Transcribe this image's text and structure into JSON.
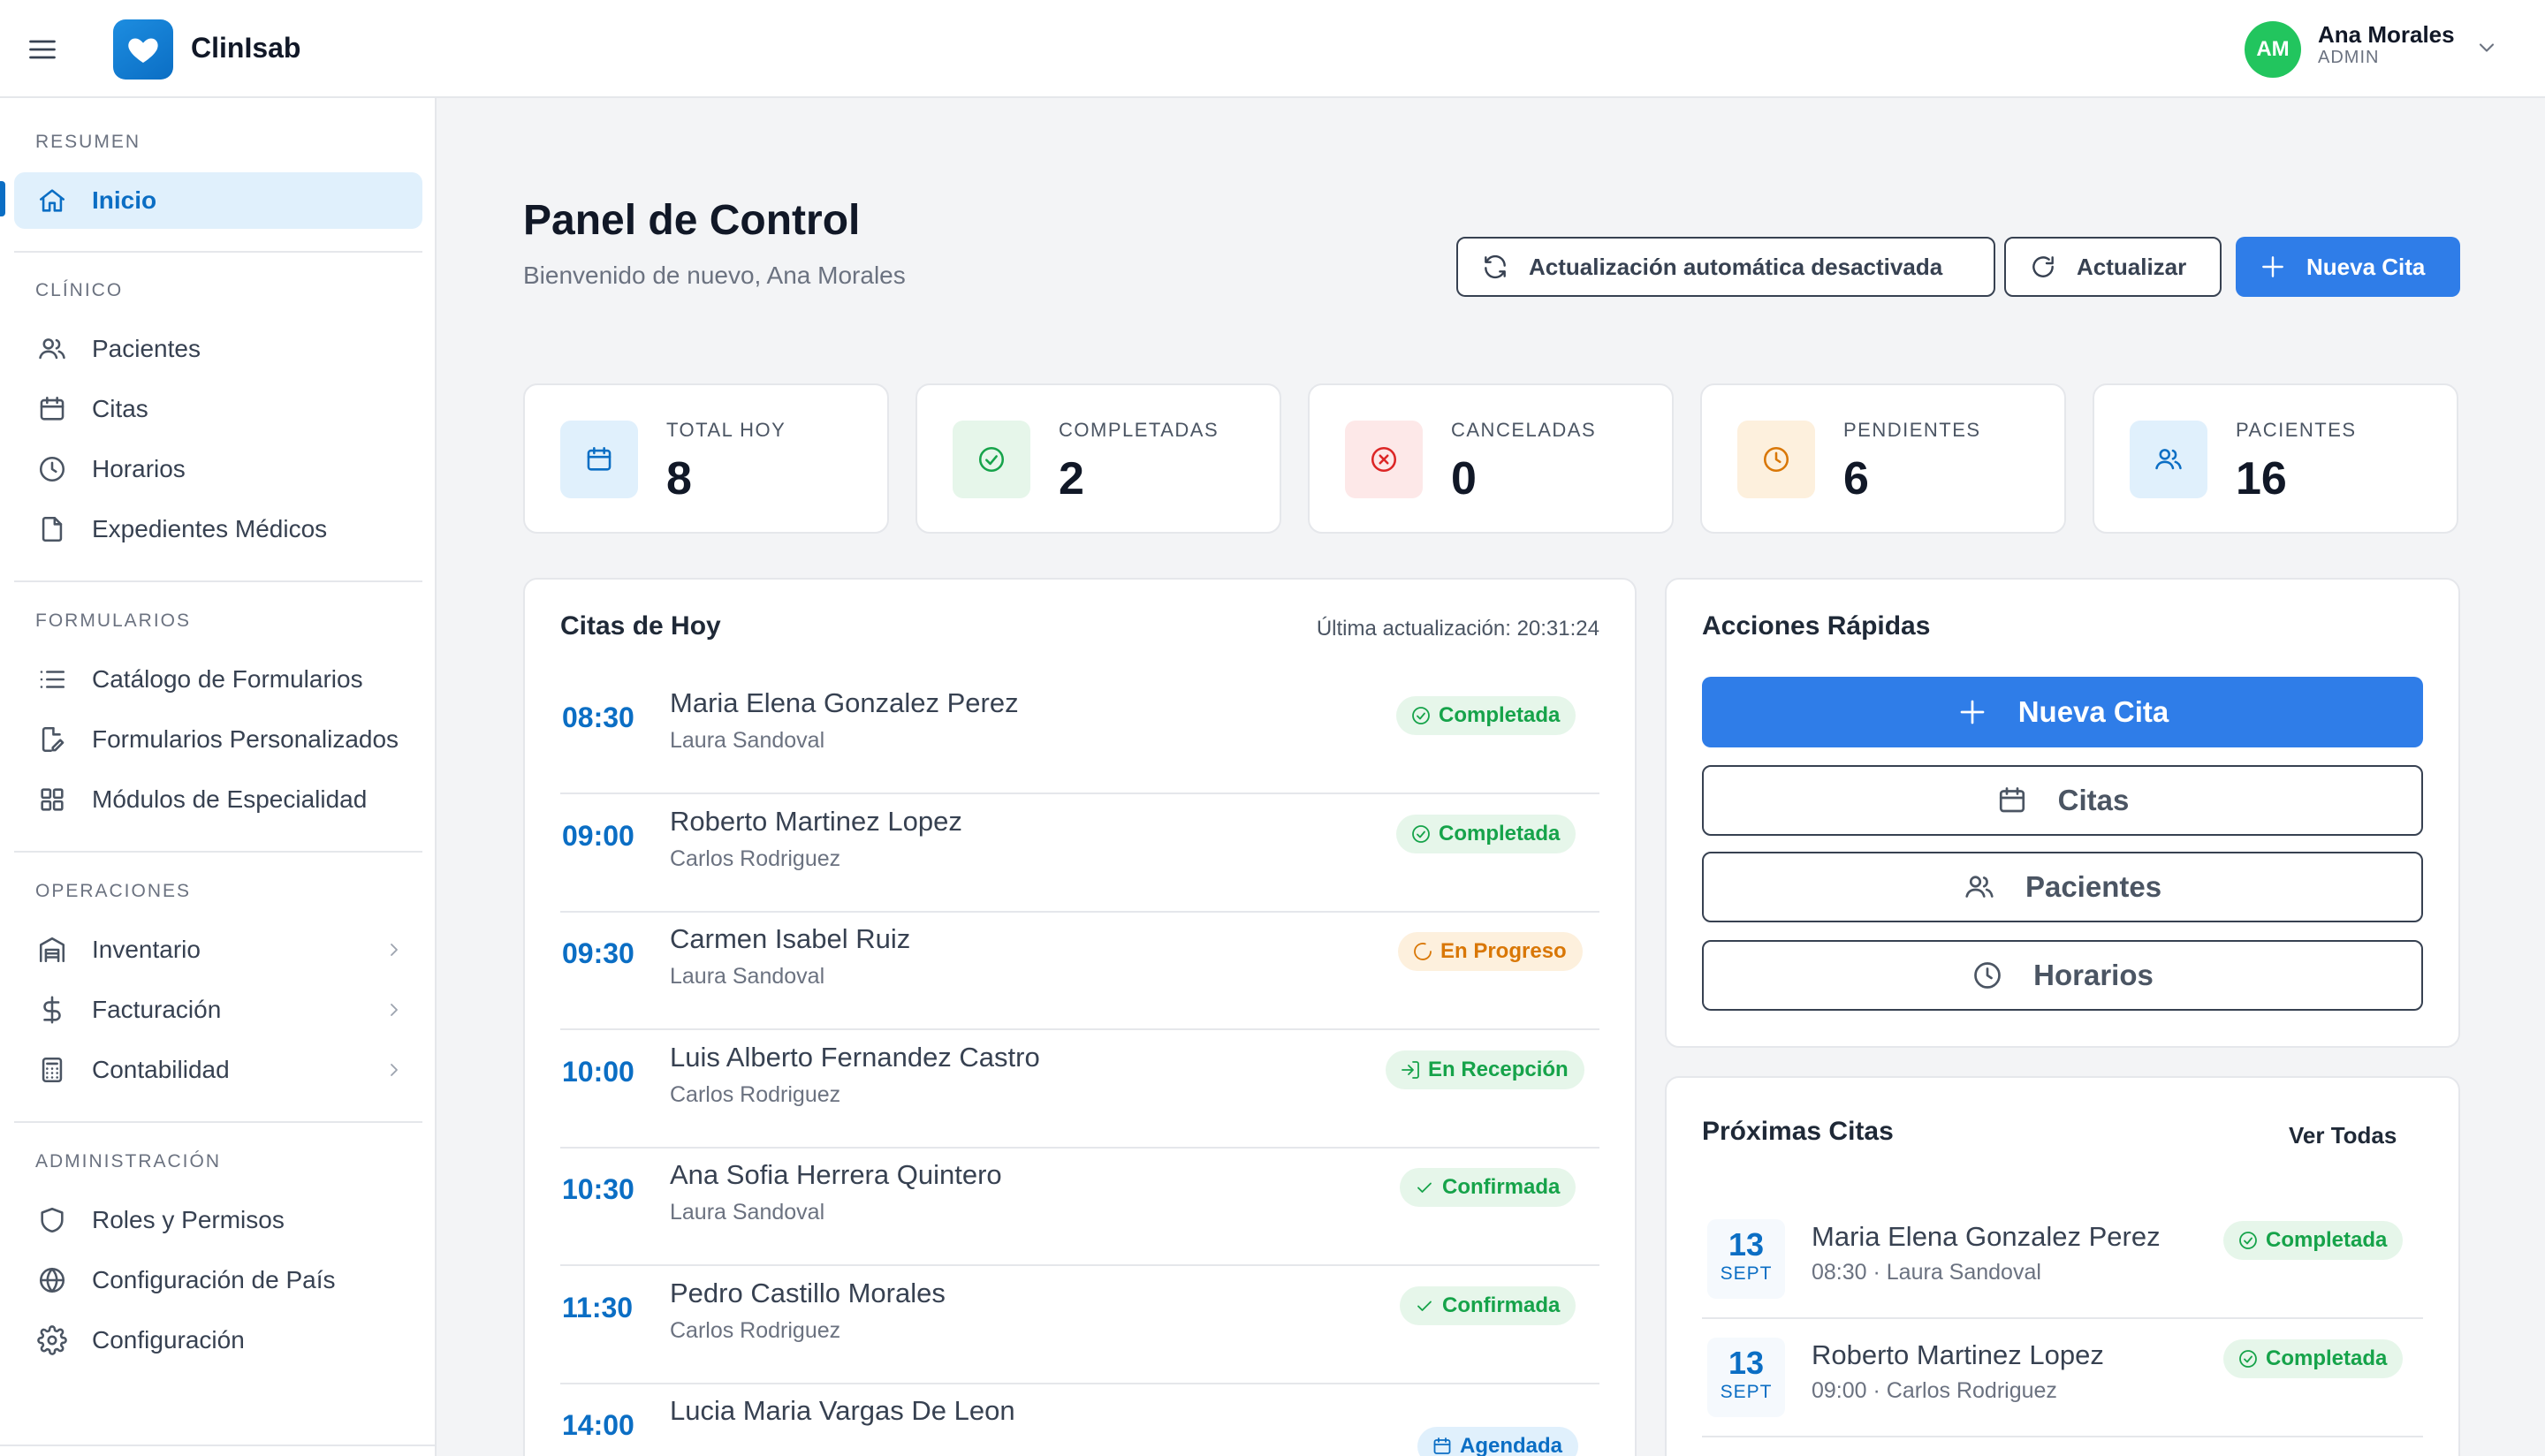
{
  "app": {
    "brand": "ClinIsab"
  },
  "user": {
    "name": "Ana Morales",
    "role": "ADMIN",
    "initials": "AM"
  },
  "sidebar": {
    "sections": [
      {
        "title": "RESUMEN",
        "items": [
          {
            "label": "Inicio",
            "icon": "home-icon",
            "active": true
          }
        ]
      },
      {
        "title": "CLÍNICO",
        "items": [
          {
            "label": "Pacientes",
            "icon": "users-icon"
          },
          {
            "label": "Citas",
            "icon": "calendar-icon"
          },
          {
            "label": "Horarios",
            "icon": "clock-icon"
          },
          {
            "label": "Expedientes Médicos",
            "icon": "file-icon"
          }
        ]
      },
      {
        "title": "FORMULARIOS",
        "items": [
          {
            "label": "Catálogo de Formularios",
            "icon": "list-icon"
          },
          {
            "label": "Formularios Personalizados",
            "icon": "file-edit-icon"
          },
          {
            "label": "Módulos de Especialidad",
            "icon": "grid-icon"
          }
        ]
      },
      {
        "title": "OPERACIONES",
        "items": [
          {
            "label": "Inventario",
            "icon": "warehouse-icon",
            "expandable": true
          },
          {
            "label": "Facturación",
            "icon": "dollar-icon",
            "expandable": true
          },
          {
            "label": "Contabilidad",
            "icon": "calculator-icon",
            "expandable": true
          }
        ]
      },
      {
        "title": "ADMINISTRACIÓN",
        "items": [
          {
            "label": "Roles y Permisos",
            "icon": "shield-icon"
          },
          {
            "label": "Configuración de País",
            "icon": "globe-icon"
          },
          {
            "label": "Configuración",
            "icon": "gear-icon"
          }
        ]
      }
    ]
  },
  "header": {
    "title": "Panel de Control",
    "subtitle": "Bienvenido de nuevo, Ana Morales",
    "auto_refresh_label": "Actualización automática desactivada",
    "refresh_label": "Actualizar",
    "new_appointment_label": "Nueva Cita"
  },
  "stats": [
    {
      "label": "TOTAL HOY",
      "value": "8",
      "icon": "calendar-icon",
      "color": "#0b6ec4",
      "bg": "#e0f0fc"
    },
    {
      "label": "COMPLETADAS",
      "value": "2",
      "icon": "check-circle-icon",
      "color": "#16a34a",
      "bg": "#e6f6ea"
    },
    {
      "label": "CANCELADAS",
      "value": "0",
      "icon": "x-circle-icon",
      "color": "#dc2626",
      "bg": "#fde8e8"
    },
    {
      "label": "PENDIENTES",
      "value": "6",
      "icon": "clock-icon",
      "color": "#d97706",
      "bg": "#fdf0dd"
    },
    {
      "label": "PACIENTES",
      "value": "16",
      "icon": "users-icon",
      "color": "#0b6ec4",
      "bg": "#e0f0fc"
    }
  ],
  "today": {
    "title": "Citas de Hoy",
    "last_update": "Última actualización: 20:31:24",
    "appointments": [
      {
        "time": "08:30",
        "patient": "Maria Elena Gonzalez Perez",
        "doctor": "Laura Sandoval",
        "status": "Completada",
        "variant": "green",
        "icon": "check-circle-icon"
      },
      {
        "time": "09:00",
        "patient": "Roberto Martinez Lopez",
        "doctor": "Carlos Rodriguez",
        "status": "Completada",
        "variant": "green",
        "icon": "check-circle-icon"
      },
      {
        "time": "09:30",
        "patient": "Carmen Isabel Ruiz",
        "doctor": "Laura Sandoval",
        "status": "En Progreso",
        "variant": "orange",
        "icon": "loader-icon"
      },
      {
        "time": "10:00",
        "patient": "Luis Alberto Fernandez Castro",
        "doctor": "Carlos Rodriguez",
        "status": "En Recepción",
        "variant": "green",
        "icon": "login-icon"
      },
      {
        "time": "10:30",
        "patient": "Ana Sofia Herrera Quintero",
        "doctor": "Laura Sandoval",
        "status": "Confirmada",
        "variant": "green",
        "icon": "check-icon"
      },
      {
        "time": "11:30",
        "patient": "Pedro Castillo Morales",
        "doctor": "Carlos Rodriguez",
        "status": "Confirmada",
        "variant": "green",
        "icon": "check-icon"
      },
      {
        "time": "14:00",
        "patient": "Lucia Maria Vargas De Leon",
        "doctor": "",
        "status": "Agendada",
        "variant": "blue",
        "icon": "calendar-icon"
      }
    ]
  },
  "quick": {
    "title": "Acciones Rápidas",
    "actions": [
      {
        "label": "Nueva Cita",
        "icon": "plus-icon",
        "primary": true
      },
      {
        "label": "Citas",
        "icon": "calendar-icon"
      },
      {
        "label": "Pacientes",
        "icon": "users-icon"
      },
      {
        "label": "Horarios",
        "icon": "clock-icon"
      }
    ]
  },
  "upcoming": {
    "title": "Próximas Citas",
    "view_all": "Ver Todas",
    "items": [
      {
        "day": "13",
        "month": "SEPT",
        "patient": "Maria Elena Gonzalez Perez",
        "detail": "08:30 · Laura Sandoval",
        "status": "Completada"
      },
      {
        "day": "13",
        "month": "SEPT",
        "patient": "Roberto Martinez Lopez",
        "detail": "09:00 · Carlos Rodriguez",
        "status": "Completada"
      }
    ]
  }
}
